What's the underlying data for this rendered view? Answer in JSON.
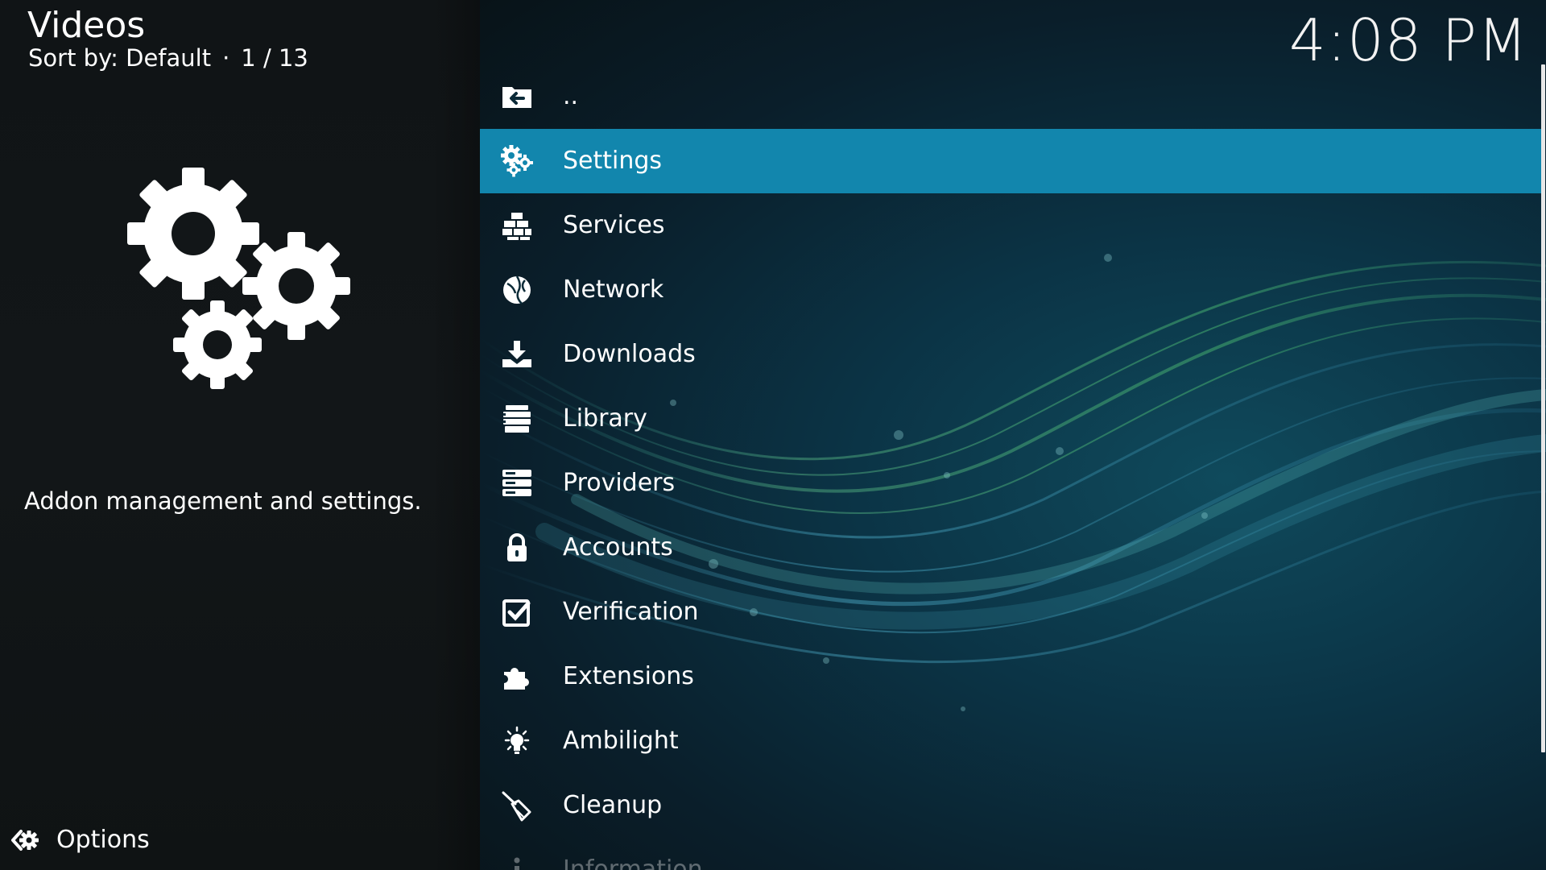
{
  "header": {
    "title": "Videos",
    "sort_label": "Sort by: Default",
    "separator": "·",
    "position": "1 / 13",
    "clock": "4:08 PM"
  },
  "info_panel": {
    "art_icon": "gears-icon",
    "description": "Addon management and settings."
  },
  "footer": {
    "options_icon": "options-icon",
    "options_label": "Options"
  },
  "list": {
    "items": [
      {
        "label": "..",
        "icon": "folder-back-icon"
      },
      {
        "label": "Settings",
        "icon": "gears-icon",
        "selected": true
      },
      {
        "label": "Services",
        "icon": "bricks-icon"
      },
      {
        "label": "Network",
        "icon": "globe-icon"
      },
      {
        "label": "Downloads",
        "icon": "download-icon"
      },
      {
        "label": "Library",
        "icon": "library-icon"
      },
      {
        "label": "Providers",
        "icon": "server-icon"
      },
      {
        "label": "Accounts",
        "icon": "lock-icon"
      },
      {
        "label": "Verification",
        "icon": "checkbox-icon"
      },
      {
        "label": "Extensions",
        "icon": "puzzle-icon"
      },
      {
        "label": "Ambilight",
        "icon": "lightbulb-icon"
      },
      {
        "label": "Cleanup",
        "icon": "broom-icon"
      },
      {
        "label": "Information",
        "icon": "info-icon"
      }
    ]
  },
  "colors": {
    "selected_row": "#1286ad",
    "left_panel": "#121618",
    "background_teal": "#0b3446"
  }
}
